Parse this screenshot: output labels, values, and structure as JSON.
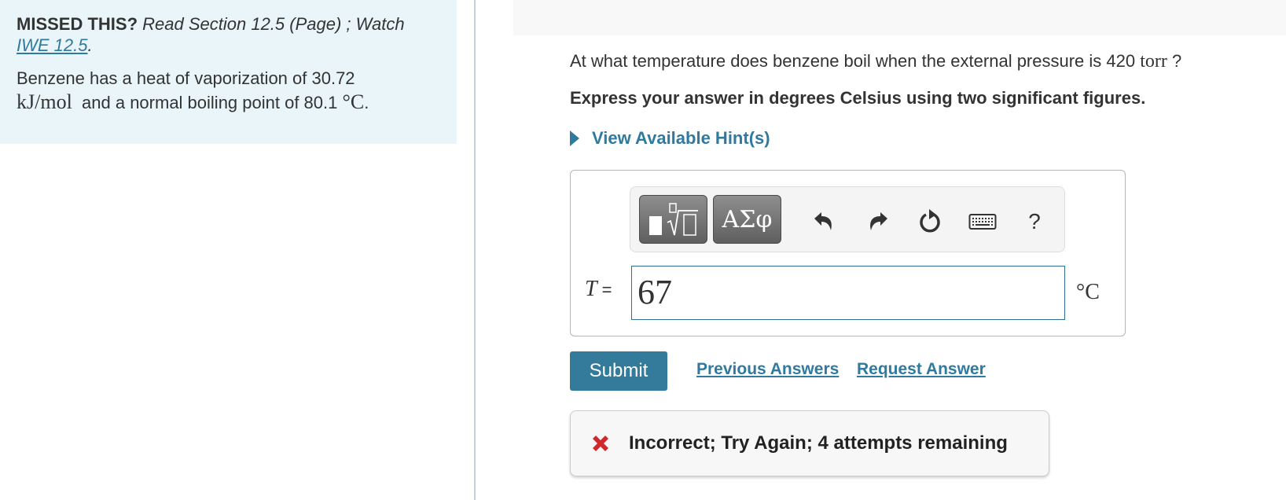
{
  "left_panel": {
    "missed_label": "MISSED THIS?",
    "read_text": "Read Section 12.5 (Page) ; Watch",
    "iwe_link": "IWE 12.5",
    "period": ".",
    "problem_prefix": "Benzene has a heat of vaporization of 30.72",
    "problem_unit": "kJ/mol",
    "problem_middle": "and a normal boiling point of 80.1",
    "problem_temp_unit": "°C",
    "problem_end": "."
  },
  "question": {
    "text": "At what temperature does benzene boil when the external pressure is 420",
    "unit": "torr",
    "end": "?",
    "instruction": "Express your answer in degrees Celsius using two significant figures.",
    "hint_label": "View Available Hint(s)"
  },
  "toolbar": {
    "templates_icon": "templates-icon",
    "greek_label": "ΑΣφ",
    "undo_icon": "undo-icon",
    "redo_icon": "redo-icon",
    "reset_icon": "reset-icon",
    "keyboard_icon": "keyboard-icon",
    "help_label": "?"
  },
  "answer": {
    "variable": "T",
    "equals": "=",
    "value": "67",
    "unit": "°C"
  },
  "actions": {
    "submit_label": "Submit",
    "previous_answers_label": "Previous Answers",
    "request_answer_label": "Request Answer"
  },
  "feedback": {
    "icon": "x-icon",
    "text": "Incorrect; Try Again; 4 attempts remaining",
    "color": "#d1282e"
  },
  "colors": {
    "accent": "#2f7a9e",
    "submit": "#337a9b",
    "panel_bg": "#e9f5f8"
  }
}
